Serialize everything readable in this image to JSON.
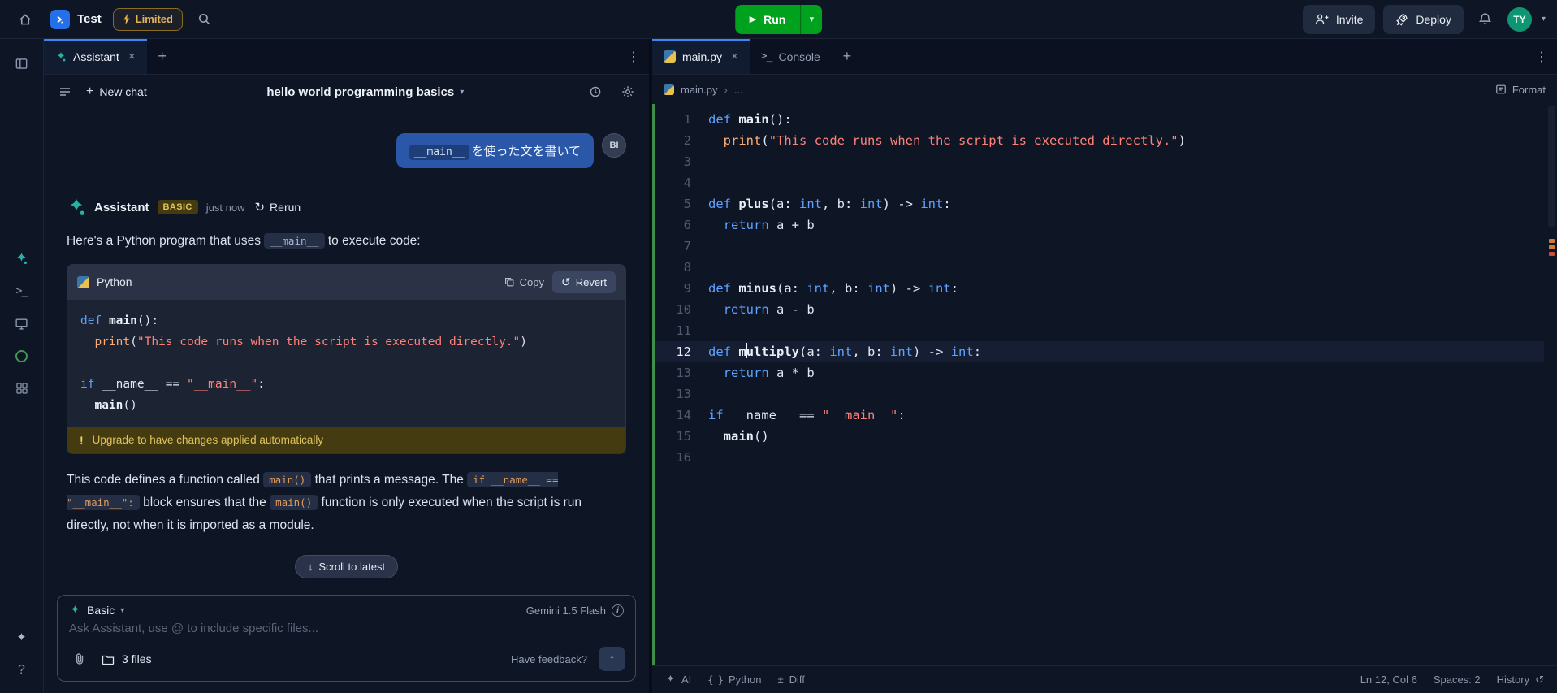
{
  "icons": {
    "close": "×",
    "plus": "+",
    "chevron_down": "▾",
    "breadcrumb_chevron": "›",
    "kebab": "⋮",
    "play": "▶",
    "rerun": "↻",
    "revert": "↺",
    "history": "↺",
    "down_arrow": "↓",
    "up_arrow": "↑",
    "shell_glyph": ">_",
    "warning_mark": "!",
    "diff_glyph": "±",
    "braces_glyph": "{ }",
    "help_glyph": "?",
    "info_glyph": "i"
  },
  "topbar": {
    "app_name": "Test",
    "limited_label": "Limited",
    "run_label": "Run",
    "invite_label": "Invite",
    "deploy_label": "Deploy",
    "avatar_initials": "TY"
  },
  "assistant": {
    "tab_label": "Assistant",
    "header": {
      "new_chat_label": "New chat",
      "chat_title": "hello world programming basics"
    },
    "user_message": [
      {
        "t": "__main__",
        "s": "bubble-code"
      },
      {
        "t": "を使った文を書いて",
        "s": "plain"
      }
    ],
    "user_avatar": "BI",
    "reply": {
      "author": "Assistant",
      "badge": "BASIC",
      "timestamp": "just now",
      "rerun_label": "Rerun",
      "intro": [
        {
          "t": "Here's a Python program that uses ",
          "s": "plain"
        },
        {
          "t": "__main__",
          "s": "chip-muted"
        },
        {
          "t": " to execute code:",
          "s": "plain"
        }
      ],
      "code_block": {
        "language": "Python",
        "copy_label": "Copy",
        "revert_label": "Revert",
        "lines": [
          {
            "t": [
              [
                "kw",
                "def"
              ],
              [
                "pl",
                " "
              ],
              [
                "fn",
                "main"
              ],
              [
                "pl",
                "():"
              ]
            ]
          },
          {
            "t": [
              [
                "pl",
                "  "
              ],
              [
                "call",
                "print"
              ],
              [
                "pl",
                "("
              ],
              [
                "str",
                "\"This code runs when the script is executed directly.\""
              ],
              [
                "pl",
                ")"
              ]
            ]
          },
          {
            "t": []
          },
          {
            "t": [
              [
                "kw",
                "if"
              ],
              [
                "pl",
                " __name__ == "
              ],
              [
                "str",
                "\"__main__\""
              ],
              [
                "pl",
                ":"
              ]
            ]
          },
          {
            "t": [
              [
                "pl",
                "  "
              ],
              [
                "fn",
                "main"
              ],
              [
                "pl",
                "()"
              ]
            ]
          }
        ],
        "warning": "Upgrade to have changes applied automatically"
      },
      "explanation": [
        {
          "t": "This code defines a function called ",
          "s": "plain"
        },
        {
          "t": "main()",
          "s": "chip-orange"
        },
        {
          "t": " that prints a message. The ",
          "s": "plain"
        },
        {
          "t": "if __name__ == \"__main__\":",
          "s": "chip-orange"
        },
        {
          "t": " block ensures that the ",
          "s": "plain"
        },
        {
          "t": "main()",
          "s": "chip-orange"
        },
        {
          "t": " function is only executed when the script is run directly, not when it is imported as a module.",
          "s": "plain"
        }
      ]
    },
    "scroll_latest_label": "Scroll to latest",
    "composer": {
      "tier_label": "Basic",
      "model_label": "Gemini 1.5 Flash",
      "placeholder": "Ask Assistant, use @ to include specific files...",
      "files_label": "3 files",
      "feedback_label": "Have feedback?"
    }
  },
  "editor": {
    "tabs": [
      {
        "label": "main.py"
      },
      {
        "label": "Console"
      }
    ],
    "breadcrumb": {
      "file": "main.py",
      "more": "..."
    },
    "format_label": "Format",
    "lines": [
      {
        "n": "1",
        "t": [
          [
            "kw",
            "def"
          ],
          [
            "pl",
            " "
          ],
          [
            "fn",
            "main"
          ],
          [
            "pl",
            "():"
          ]
        ]
      },
      {
        "n": "2",
        "t": [
          [
            "pl",
            "  "
          ],
          [
            "call",
            "print"
          ],
          [
            "pl",
            "("
          ],
          [
            "str",
            "\"This code runs when the script is executed directly.\""
          ],
          [
            "pl",
            ")"
          ]
        ]
      },
      {
        "n": "3",
        "t": []
      },
      {
        "n": "4",
        "t": []
      },
      {
        "n": "5",
        "t": [
          [
            "kw",
            "def"
          ],
          [
            "pl",
            " "
          ],
          [
            "fn",
            "plus"
          ],
          [
            "pl",
            "(a: "
          ],
          [
            "kw",
            "int"
          ],
          [
            "pl",
            ", b: "
          ],
          [
            "kw",
            "int"
          ],
          [
            "pl",
            ") -> "
          ],
          [
            "kw",
            "int"
          ],
          [
            "pl",
            ":"
          ]
        ]
      },
      {
        "n": "6",
        "t": [
          [
            "pl",
            "  "
          ],
          [
            "kw",
            "return"
          ],
          [
            "pl",
            " a + b"
          ]
        ]
      },
      {
        "n": "7",
        "t": []
      },
      {
        "n": "8",
        "t": []
      },
      {
        "n": "9",
        "t": [
          [
            "kw",
            "def"
          ],
          [
            "pl",
            " "
          ],
          [
            "fn",
            "minus"
          ],
          [
            "pl",
            "(a: "
          ],
          [
            "kw",
            "int"
          ],
          [
            "pl",
            ", b: "
          ],
          [
            "kw",
            "int"
          ],
          [
            "pl",
            ") -> "
          ],
          [
            "kw",
            "int"
          ],
          [
            "pl",
            ":"
          ]
        ]
      },
      {
        "n": "10",
        "t": [
          [
            "pl",
            "  "
          ],
          [
            "kw",
            "return"
          ],
          [
            "pl",
            " a - b"
          ]
        ]
      },
      {
        "n": "11",
        "t": []
      },
      {
        "n": "12",
        "active": true,
        "t": [
          [
            "kw",
            "def"
          ],
          [
            "pl",
            " "
          ],
          [
            "fn",
            "m"
          ],
          [
            "caret",
            ""
          ],
          [
            "fn",
            "ultiply"
          ],
          [
            "pl",
            "(a: "
          ],
          [
            "kw",
            "int"
          ],
          [
            "pl",
            ", b: "
          ],
          [
            "kw",
            "int"
          ],
          [
            "pl",
            ") -> "
          ],
          [
            "kw",
            "int"
          ],
          [
            "pl",
            ":"
          ]
        ]
      },
      {
        "n": "13",
        "t": [
          [
            "pl",
            "  "
          ],
          [
            "kw",
            "return"
          ],
          [
            "pl",
            " a * b"
          ]
        ]
      },
      {
        "n": "13",
        "t": []
      },
      {
        "n": "14",
        "t": [
          [
            "kw",
            "if"
          ],
          [
            "pl",
            " __name__ == "
          ],
          [
            "str",
            "\"__main__\""
          ],
          [
            "pl",
            ":"
          ]
        ]
      },
      {
        "n": "15",
        "t": [
          [
            "pl",
            "  "
          ],
          [
            "fn",
            "main"
          ],
          [
            "pl",
            "()"
          ]
        ]
      },
      {
        "n": "16",
        "t": []
      }
    ],
    "statusbar": {
      "ai_label": "AI",
      "language_label": "Python",
      "diff_label": "Diff",
      "cursor_position": "Ln 12, Col 6",
      "spaces": "Spaces: 2",
      "history_label": "History"
    }
  }
}
